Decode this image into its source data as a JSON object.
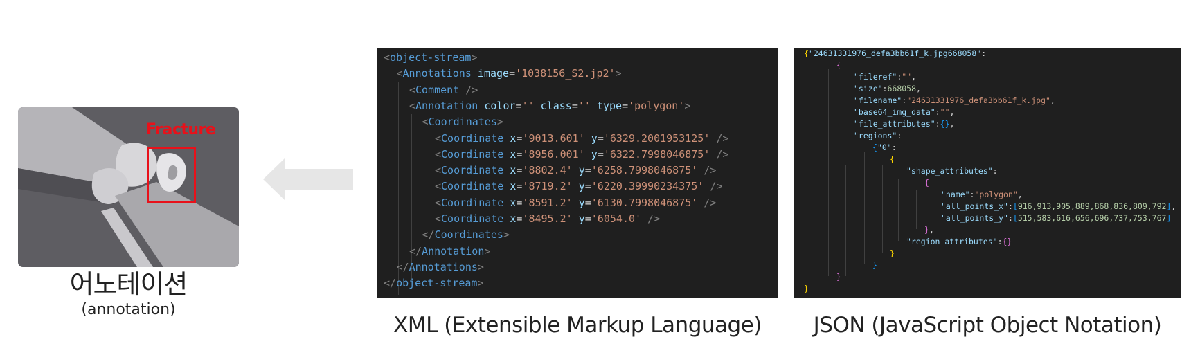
{
  "annotation_card": {
    "fracture_label": "Fracture",
    "title_korean": "어노테이션",
    "title_english": "(annotation)"
  },
  "xml": {
    "caption": "XML (Extensible Markup Language)",
    "lines": [
      [
        [
          "br",
          "<"
        ],
        [
          "tag",
          "object-stream"
        ],
        [
          "br",
          ">"
        ]
      ],
      [
        [
          "br",
          "<"
        ],
        [
          "tag",
          "Annotations"
        ],
        [
          "sp",
          " "
        ],
        [
          "attr",
          "image"
        ],
        [
          "eq",
          "="
        ],
        [
          "str",
          "'1038156_S2.jp2'"
        ],
        [
          "br",
          ">"
        ]
      ],
      [
        [
          "br",
          "<"
        ],
        [
          "tag",
          "Comment"
        ],
        [
          "sp",
          " "
        ],
        [
          "br",
          "/>"
        ]
      ],
      [
        [
          "br",
          "<"
        ],
        [
          "tag",
          "Annotation"
        ],
        [
          "sp",
          " "
        ],
        [
          "attr",
          "color"
        ],
        [
          "eq",
          "="
        ],
        [
          "str",
          "''"
        ],
        [
          "sp",
          " "
        ],
        [
          "attr",
          "class"
        ],
        [
          "eq",
          "="
        ],
        [
          "str",
          "''"
        ],
        [
          "sp",
          " "
        ],
        [
          "attr",
          "type"
        ],
        [
          "eq",
          "="
        ],
        [
          "str",
          "'polygon'"
        ],
        [
          "br",
          ">"
        ]
      ],
      [
        [
          "br",
          "<"
        ],
        [
          "tag",
          "Coordinates"
        ],
        [
          "br",
          ">"
        ]
      ],
      [
        [
          "br",
          "<"
        ],
        [
          "tag",
          "Coordinate"
        ],
        [
          "sp",
          " "
        ],
        [
          "attr",
          "x"
        ],
        [
          "eq",
          "="
        ],
        [
          "str",
          "'9013.601'"
        ],
        [
          "sp",
          " "
        ],
        [
          "attr",
          "y"
        ],
        [
          "eq",
          "="
        ],
        [
          "str",
          "'6329.2001953125'"
        ],
        [
          "sp",
          " "
        ],
        [
          "br",
          "/>"
        ]
      ],
      [
        [
          "br",
          "<"
        ],
        [
          "tag",
          "Coordinate"
        ],
        [
          "sp",
          " "
        ],
        [
          "attr",
          "x"
        ],
        [
          "eq",
          "="
        ],
        [
          "str",
          "'8956.001'"
        ],
        [
          "sp",
          " "
        ],
        [
          "attr",
          "y"
        ],
        [
          "eq",
          "="
        ],
        [
          "str",
          "'6322.7998046875'"
        ],
        [
          "sp",
          " "
        ],
        [
          "br",
          "/>"
        ]
      ],
      [
        [
          "br",
          "<"
        ],
        [
          "tag",
          "Coordinate"
        ],
        [
          "sp",
          " "
        ],
        [
          "attr",
          "x"
        ],
        [
          "eq",
          "="
        ],
        [
          "str",
          "'8802.4'"
        ],
        [
          "sp",
          " "
        ],
        [
          "attr",
          "y"
        ],
        [
          "eq",
          "="
        ],
        [
          "str",
          "'6258.7998046875'"
        ],
        [
          "sp",
          " "
        ],
        [
          "br",
          "/>"
        ]
      ],
      [
        [
          "br",
          "<"
        ],
        [
          "tag",
          "Coordinate"
        ],
        [
          "sp",
          " "
        ],
        [
          "attr",
          "x"
        ],
        [
          "eq",
          "="
        ],
        [
          "str",
          "'8719.2'"
        ],
        [
          "sp",
          " "
        ],
        [
          "attr",
          "y"
        ],
        [
          "eq",
          "="
        ],
        [
          "str",
          "'6220.39990234375'"
        ],
        [
          "sp",
          " "
        ],
        [
          "br",
          "/>"
        ]
      ],
      [
        [
          "br",
          "<"
        ],
        [
          "tag",
          "Coordinate"
        ],
        [
          "sp",
          " "
        ],
        [
          "attr",
          "x"
        ],
        [
          "eq",
          "="
        ],
        [
          "str",
          "'8591.2'"
        ],
        [
          "sp",
          " "
        ],
        [
          "attr",
          "y"
        ],
        [
          "eq",
          "="
        ],
        [
          "str",
          "'6130.7998046875'"
        ],
        [
          "sp",
          " "
        ],
        [
          "br",
          "/>"
        ]
      ],
      [
        [
          "br",
          "<"
        ],
        [
          "tag",
          "Coordinate"
        ],
        [
          "sp",
          " "
        ],
        [
          "attr",
          "x"
        ],
        [
          "eq",
          "="
        ],
        [
          "str",
          "'8495.2'"
        ],
        [
          "sp",
          " "
        ],
        [
          "attr",
          "y"
        ],
        [
          "eq",
          "="
        ],
        [
          "str",
          "'6054.0'"
        ],
        [
          "sp",
          " "
        ],
        [
          "br",
          "/>"
        ]
      ],
      [
        [
          "br",
          "</"
        ],
        [
          "tag",
          "Coordinates"
        ],
        [
          "br",
          ">"
        ]
      ],
      [
        [
          "br",
          "</"
        ],
        [
          "tag",
          "Annotation"
        ],
        [
          "br",
          ">"
        ]
      ],
      [
        [
          "br",
          "</"
        ],
        [
          "tag",
          "Annotations"
        ],
        [
          "br",
          ">"
        ]
      ],
      [
        [
          "br",
          "</"
        ],
        [
          "tag",
          "object-stream"
        ],
        [
          "br",
          ">"
        ]
      ]
    ]
  },
  "json": {
    "caption": "JSON (JavaScript Object Notation)",
    "lines": [
      [
        [
          "b1",
          "{"
        ],
        [
          "key",
          "\"24631331976_defa3bb61f_k.jpg668058\""
        ],
        [
          "p",
          ":"
        ]
      ],
      [
        [
          "b2",
          "{"
        ]
      ],
      [
        [
          "key",
          "\"fileref\""
        ],
        [
          "p",
          ":"
        ],
        [
          "str",
          "\"\""
        ],
        [
          "p",
          ","
        ]
      ],
      [
        [
          "key",
          "\"size\""
        ],
        [
          "p",
          ":"
        ],
        [
          "num",
          "668058"
        ],
        [
          "p",
          ","
        ]
      ],
      [
        [
          "key",
          "\"filename\""
        ],
        [
          "p",
          ":"
        ],
        [
          "str",
          "\"24631331976_defa3bb61f_k.jpg\""
        ],
        [
          "p",
          ","
        ]
      ],
      [
        [
          "key",
          "\"base64_img_data\""
        ],
        [
          "p",
          ":"
        ],
        [
          "str",
          "\"\""
        ],
        [
          "p",
          ","
        ]
      ],
      [
        [
          "key",
          "\"file_attributes\""
        ],
        [
          "p",
          ":"
        ],
        [
          "b3",
          "{}"
        ],
        [
          "p",
          ","
        ]
      ],
      [
        [
          "key",
          "\"regions\""
        ],
        [
          "p",
          ":"
        ]
      ],
      [
        [
          "b3",
          "{"
        ],
        [
          "key",
          "\"0\""
        ],
        [
          "p",
          ":"
        ]
      ],
      [
        [
          "b1",
          "{"
        ]
      ],
      [
        [
          "key",
          "\"shape_attributes\""
        ],
        [
          "p",
          ":"
        ]
      ],
      [
        [
          "b2",
          "{"
        ]
      ],
      [
        [
          "key",
          "\"name\""
        ],
        [
          "p",
          ":"
        ],
        [
          "str",
          "\"polygon\""
        ],
        [
          "p",
          ","
        ]
      ],
      [
        [
          "key",
          "\"all_points_x\""
        ],
        [
          "p",
          ":"
        ],
        [
          "b3",
          "["
        ],
        [
          "num",
          "916,913,905,889,868,836,809,792"
        ],
        [
          "b3",
          "]"
        ],
        [
          "p",
          ","
        ]
      ],
      [
        [
          "key",
          "\"all_points_y\""
        ],
        [
          "p",
          ":"
        ],
        [
          "b3",
          "["
        ],
        [
          "num",
          "515,583,616,656,696,737,753,767"
        ],
        [
          "b3",
          "]"
        ]
      ],
      [
        [
          "b2",
          "}"
        ],
        [
          "p",
          ","
        ]
      ],
      [
        [
          "key",
          "\"region_attributes\""
        ],
        [
          "p",
          ":"
        ],
        [
          "b2",
          "{}"
        ]
      ],
      [
        [
          "b1",
          "}"
        ]
      ],
      [
        [
          "b3",
          "}"
        ]
      ],
      [
        [
          "b2",
          "}"
        ]
      ],
      [
        [
          "b1",
          "}"
        ]
      ]
    ]
  }
}
